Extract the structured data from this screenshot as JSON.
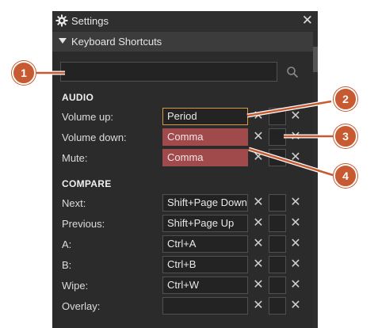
{
  "panel": {
    "title": "Settings",
    "close_glyph": "✕",
    "section_title": "Keyboard Shortcuts",
    "search_placeholder": ""
  },
  "groups": {
    "audio": "AUDIO",
    "compare": "COMPARE"
  },
  "shortcuts": [
    {
      "label": "Volume up:",
      "key": "Period",
      "state": "active"
    },
    {
      "label": "Volume down:",
      "key": "Comma",
      "state": "conflict"
    },
    {
      "label": "Mute:",
      "key": "Comma",
      "state": "conflict"
    },
    {
      "label": "Next:",
      "key": "Shift+Page Down",
      "state": "normal"
    },
    {
      "label": "Previous:",
      "key": "Shift+Page Up",
      "state": "normal"
    },
    {
      "label": "A:",
      "key": "Ctrl+A",
      "state": "normal"
    },
    {
      "label": "B:",
      "key": "Ctrl+B",
      "state": "normal"
    },
    {
      "label": "Wipe:",
      "key": "Ctrl+W",
      "state": "normal"
    },
    {
      "label": "Overlay:",
      "key": "",
      "state": "normal"
    }
  ],
  "clear_glyph": "✕",
  "callouts": [
    "1",
    "2",
    "3",
    "4"
  ],
  "icons": {
    "settings": "gear-icon",
    "search": "search-icon",
    "collapse": "triangle-down-icon"
  },
  "colors": {
    "callout": "#c85a32",
    "conflict": "#a04a4c",
    "active_border": "#d89a3c",
    "panel_bg": "#2b2b2b"
  }
}
